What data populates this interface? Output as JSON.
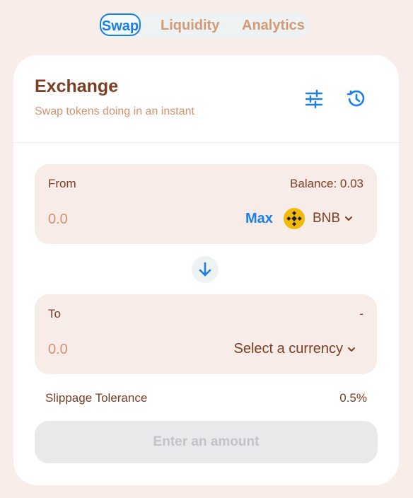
{
  "nav": {
    "tabs": [
      {
        "label": "Swap",
        "active": true
      },
      {
        "label": "Liquidity",
        "active": false
      },
      {
        "label": "Analytics",
        "active": false
      }
    ]
  },
  "header": {
    "title": "Exchange",
    "subtitle": "Swap tokens doing in an instant",
    "settings_icon": "sliders-icon",
    "history_icon": "history-icon"
  },
  "from": {
    "label": "From",
    "balance": "Balance: 0.03",
    "amount_placeholder": "0.0",
    "max_label": "Max",
    "token": "BNB",
    "token_icon": "bnb-logo"
  },
  "switch_icon": "arrow-down-icon",
  "to": {
    "label": "To",
    "balance": "-",
    "amount_placeholder": "0.0",
    "currency_label": "Select a currency"
  },
  "slippage": {
    "label": "Slippage Tolerance",
    "value": "0.5%"
  },
  "submit": {
    "label": "Enter an amount"
  },
  "colors": {
    "background": "#f8ede9",
    "accent": "#1a7fe8",
    "text": "#7a3e22",
    "muted": "#d4926f",
    "panel": "#f8ece8",
    "bnb": "#f0b90b"
  }
}
